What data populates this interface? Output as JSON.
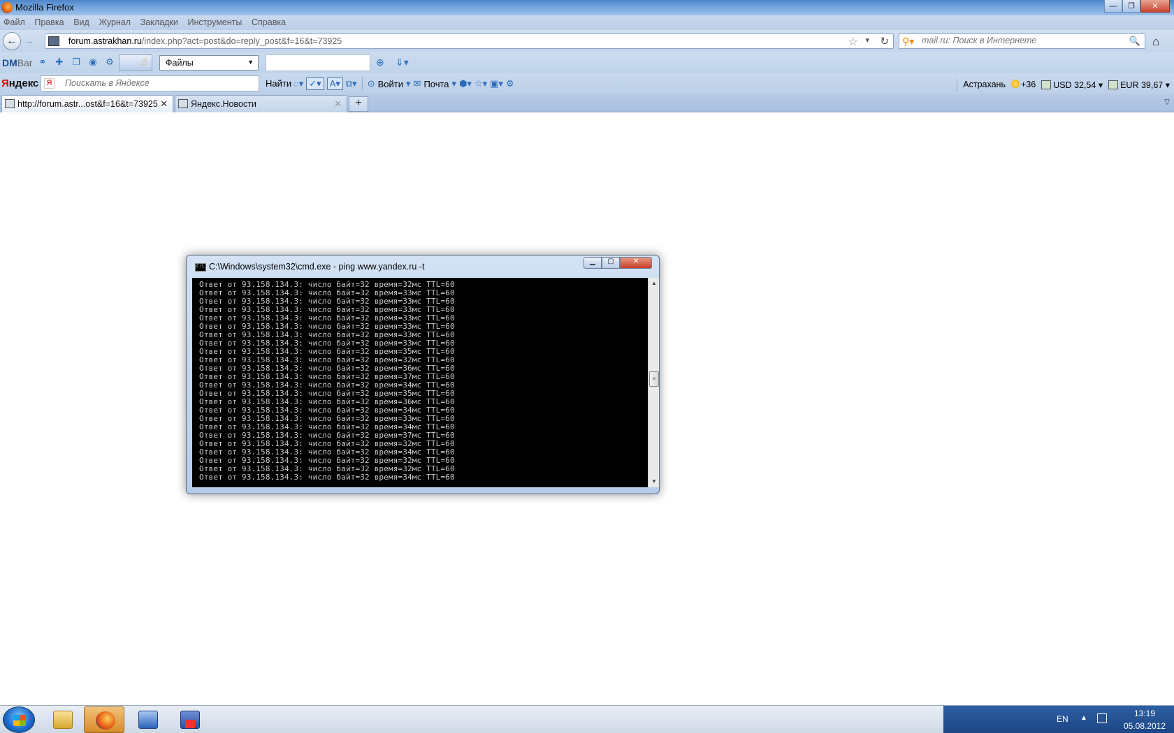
{
  "window": {
    "title": "Mozilla Firefox",
    "controls": {
      "minimize": "—",
      "maximize": "❐",
      "close": "✕"
    }
  },
  "menu": {
    "items": [
      "Файл",
      "Правка",
      "Вид",
      "Журнал",
      "Закладки",
      "Инструменты",
      "Справка"
    ]
  },
  "nav": {
    "url_host": "forum.astrakhan.ru",
    "url_path": "/index.php?act=post&do=reply_post&f=16&t=73925",
    "search_placeholder": "mail.ru: Поиск в Интернете"
  },
  "dmbar": {
    "logo_dm": "DM",
    "logo_bar": "Bar",
    "files_select": "Файлы"
  },
  "yandex": {
    "logo_ya": "Я",
    "logo_rest": "ндекс",
    "search_placeholder": "Поискать в Яндексе",
    "find_label": "Найти",
    "login_label": "Войти",
    "mail_label": "Почта",
    "city": "Астрахань",
    "weather": "+36",
    "usd": "USD 32,54",
    "eur": "EUR 39,67"
  },
  "tabs": [
    {
      "label": "http://forum.astr...ost&f=16&t=73925",
      "active": true
    },
    {
      "label": "Яндекс.Новости",
      "active": false
    }
  ],
  "cmd": {
    "title": "C:\\Windows\\system32\\cmd.exe - ping  www.yandex.ru -t",
    "lines": [
      "Ответ от 93.158.134.3: число байт=32 время=32мс TTL=60",
      "Ответ от 93.158.134.3: число байт=32 время=33мс TTL=60",
      "Ответ от 93.158.134.3: число байт=32 время=33мс TTL=60",
      "Ответ от 93.158.134.3: число байт=32 время=33мс TTL=60",
      "Ответ от 93.158.134.3: число байт=32 время=33мс TTL=60",
      "Ответ от 93.158.134.3: число байт=32 время=33мс TTL=60",
      "Ответ от 93.158.134.3: число байт=32 время=33мс TTL=60",
      "Ответ от 93.158.134.3: число байт=32 время=33мс TTL=60",
      "Ответ от 93.158.134.3: число байт=32 время=35мс TTL=60",
      "Ответ от 93.158.134.3: число байт=32 время=32мс TTL=60",
      "Ответ от 93.158.134.3: число байт=32 время=36мс TTL=60",
      "Ответ от 93.158.134.3: число байт=32 время=37мс TTL=60",
      "Ответ от 93.158.134.3: число байт=32 время=34мс TTL=60",
      "Ответ от 93.158.134.3: число байт=32 время=35мс TTL=60",
      "Ответ от 93.158.134.3: число байт=32 время=36мс TTL=60",
      "Ответ от 93.158.134.3: число байт=32 время=34мс TTL=60",
      "Ответ от 93.158.134.3: число байт=32 время=33мс TTL=60",
      "Ответ от 93.158.134.3: число байт=32 время=34мс TTL=60",
      "Ответ от 93.158.134.3: число байт=32 время=37мс TTL=60",
      "Ответ от 93.158.134.3: число байт=32 время=32мс TTL=60",
      "Ответ от 93.158.134.3: число байт=32 время=34мс TTL=60",
      "Ответ от 93.158.134.3: число байт=32 время=32мс TTL=60",
      "Ответ от 93.158.134.3: число байт=32 время=32мс TTL=60",
      "Ответ от 93.158.134.3: число байт=32 время=34мс TTL=60"
    ]
  },
  "taskbar": {
    "items": [
      "folder-icon",
      "firefox-icon",
      "network-icon",
      "save-icon"
    ],
    "lang": "EN",
    "time": "13:19",
    "date": "05.08.2012"
  }
}
